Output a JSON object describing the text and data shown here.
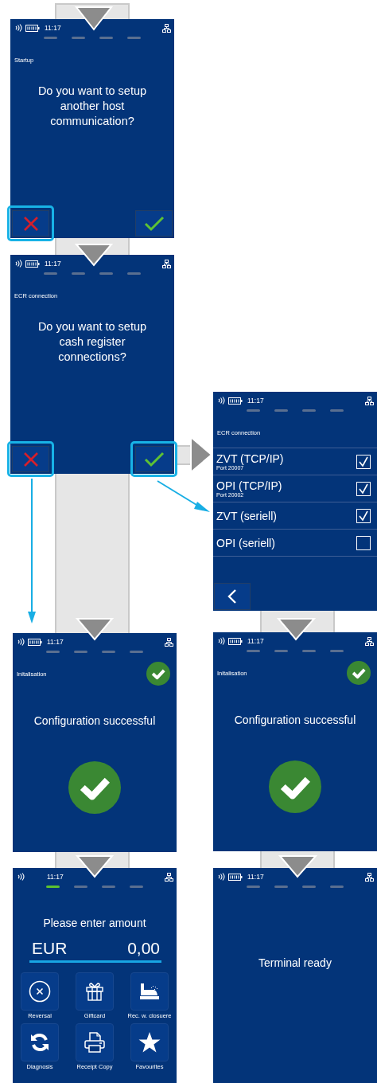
{
  "screens": [
    {
      "kind": "question",
      "status": {
        "time": "11:17",
        "battery": true
      },
      "steps": [
        {
          "active": false
        },
        {
          "active": false
        },
        {
          "active": false
        },
        {
          "active": false
        }
      ],
      "title": "Startup",
      "message": "Do you want to setup another host communication?",
      "buttons": [
        {
          "kind": "cancel",
          "highlighted": true
        },
        {
          "kind": "confirm",
          "highlighted": false
        }
      ]
    },
    {
      "kind": "question",
      "status": {
        "time": "11:17",
        "battery": true
      },
      "steps": [
        {
          "active": false
        },
        {
          "active": false
        },
        {
          "active": false
        },
        {
          "active": false
        }
      ],
      "title": "ECR connection",
      "message": "Do you want to setup cash register connections?",
      "buttons": [
        {
          "kind": "cancel",
          "highlighted": true
        },
        {
          "kind": "confirm",
          "highlighted": true
        }
      ]
    },
    {
      "kind": "checklist",
      "status": {
        "time": "11:17",
        "battery": true
      },
      "steps": [
        {
          "active": false
        },
        {
          "active": false
        },
        {
          "active": false
        },
        {
          "active": false
        }
      ],
      "title": "ECR connection",
      "items": [
        {
          "label": "ZVT (TCP/IP)",
          "sublabel": "Port 20007",
          "checked": true
        },
        {
          "label": "OPI (TCP/IP)",
          "sublabel": "Port 20002",
          "checked": true
        },
        {
          "label": "ZVT (seriell)",
          "checked": true
        },
        {
          "label": "OPI (seriell)",
          "checked": false
        }
      ]
    },
    {
      "kind": "success",
      "status": {
        "time": "11:17",
        "battery": true
      },
      "steps": [
        {
          "active": false
        },
        {
          "active": false
        },
        {
          "active": false
        },
        {
          "active": false
        }
      ],
      "title": "Initalisation",
      "message": "Configuration successful"
    },
    {
      "kind": "success",
      "status": {
        "time": "11:17",
        "battery": true
      },
      "steps": [
        {
          "active": false
        },
        {
          "active": false
        },
        {
          "active": false
        },
        {
          "active": false
        }
      ],
      "title": "Initalisation",
      "message": "Configuration successful"
    },
    {
      "kind": "amount",
      "status": {
        "time": "11:17",
        "battery": false
      },
      "steps": [
        {
          "active": true
        },
        {
          "active": false
        },
        {
          "active": false
        },
        {
          "active": false
        }
      ],
      "prompt": "Please enter amount",
      "currency": "EUR",
      "amount": "0,00",
      "tiles": [
        {
          "kind": "reversal",
          "label": "Reversal"
        },
        {
          "kind": "gift",
          "label": "Giftcard"
        },
        {
          "kind": "register",
          "label": "Rec. w. closuere"
        },
        {
          "kind": "refresh",
          "label": "Diagnosis"
        },
        {
          "kind": "printer",
          "label": "Receipt  Copy"
        },
        {
          "kind": "star",
          "label": "Favourites"
        }
      ]
    },
    {
      "kind": "message",
      "status": {
        "time": "11:17",
        "battery": true
      },
      "steps": [
        {
          "active": false
        },
        {
          "active": false
        },
        {
          "active": false
        },
        {
          "active": false
        }
      ],
      "message": "Terminal ready"
    }
  ]
}
